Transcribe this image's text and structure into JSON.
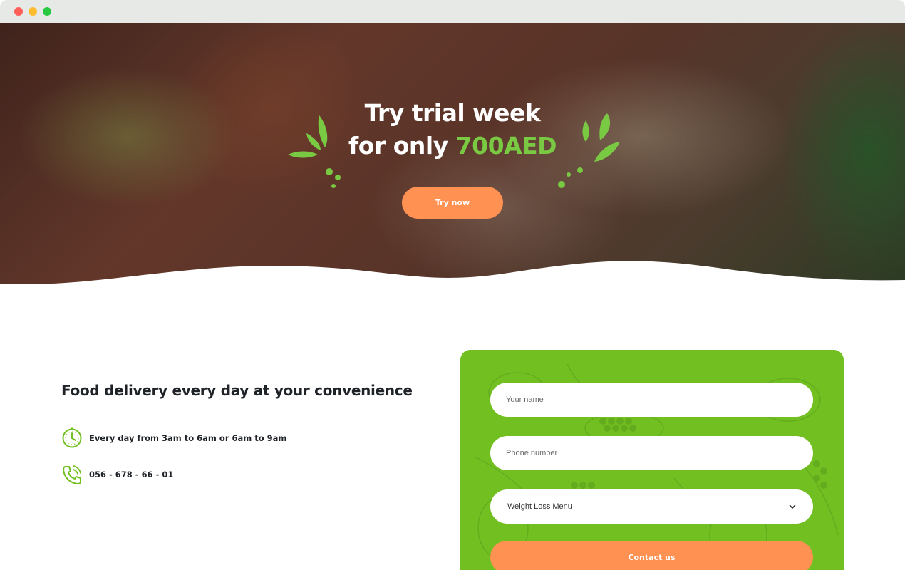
{
  "hero": {
    "title_line1": "Try trial week",
    "title_line2_prefix": "for only ",
    "title_line2_price": "700AED",
    "cta_label": "Try now"
  },
  "info": {
    "title": "Food delivery every day at your convenience",
    "items": [
      {
        "icon": "clock-icon",
        "text": "Every day from 3am to 6am or 6am to 9am"
      },
      {
        "icon": "phone-icon",
        "text": "056 - 678 - 66 - 01"
      }
    ]
  },
  "form": {
    "name_placeholder": "Your name",
    "phone_placeholder": "Phone number",
    "menu_selected": "Weight Loss Menu",
    "submit_label": "Contact us"
  },
  "colors": {
    "accent_green": "#72bf22",
    "price_green": "#7ac943",
    "button_orange": "#ff9152"
  }
}
